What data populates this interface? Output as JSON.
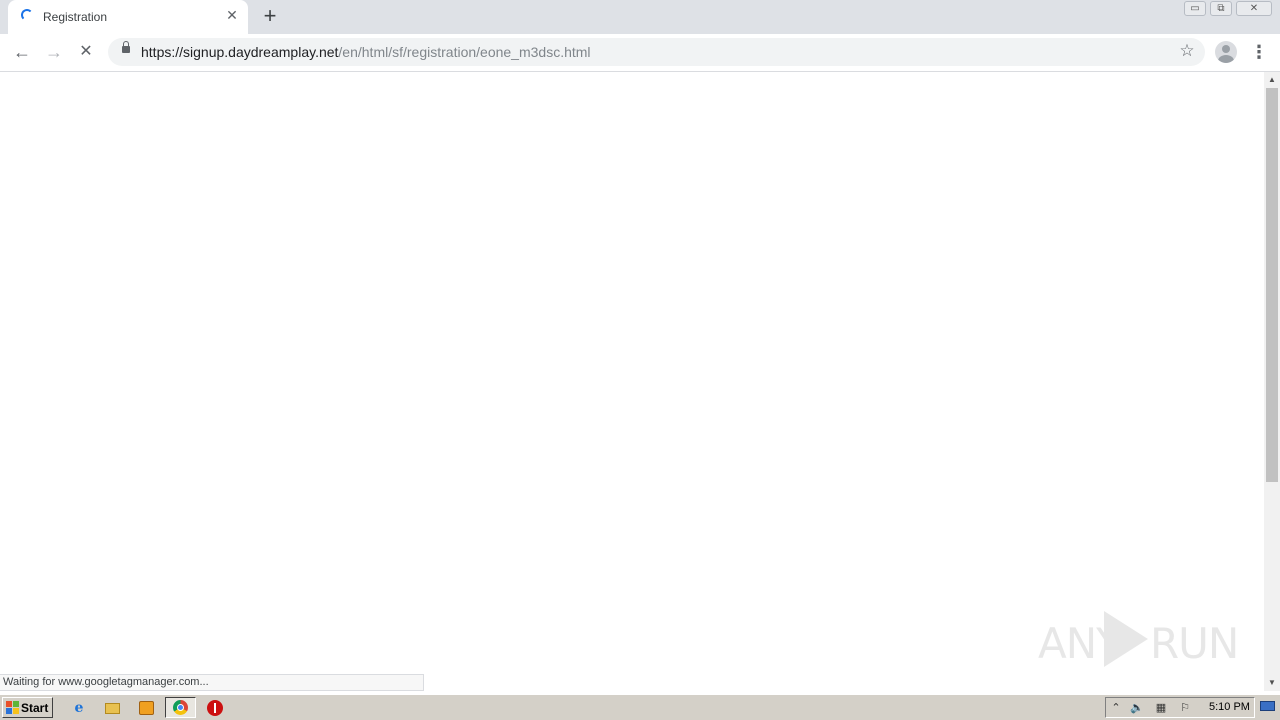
{
  "browser": {
    "tab": {
      "title": "Registration",
      "close_glyph": "✕",
      "spinner_icon": "loading-spinner-icon"
    },
    "new_tab_glyph": "+",
    "window_controls": {
      "minimize_glyph": "▭",
      "maximize_glyph": "⧉",
      "close_glyph": "✕"
    },
    "toolbar": {
      "back_glyph": "←",
      "forward_glyph": "→",
      "stop_glyph": "✕",
      "url_host": "https://signup.daydreamplay.net",
      "url_path": "/en/html/sf/registration/eone_m3dsc.html",
      "bookmark_glyph": "☆",
      "menu_glyph": "⋮"
    }
  },
  "page": {
    "status_text": "Waiting for www.googletagmanager.com...",
    "watermark": {
      "left": "ANY",
      "right": "RUN"
    },
    "scrollbar": {
      "up_glyph": "▲",
      "down_glyph": "▼"
    }
  },
  "taskbar": {
    "start_label": "Start",
    "ie_glyph": "e",
    "tray": {
      "arrow_glyph": "⌃",
      "volume_glyph": "🔈",
      "network_glyph": "▦",
      "flag_glyph": "⚐"
    },
    "clock": "5:10 PM"
  },
  "colors": {
    "tabstrip_bg": "#dee1e6",
    "spinner": "#1a73e8",
    "taskbar_bg": "#d4d0c8"
  }
}
